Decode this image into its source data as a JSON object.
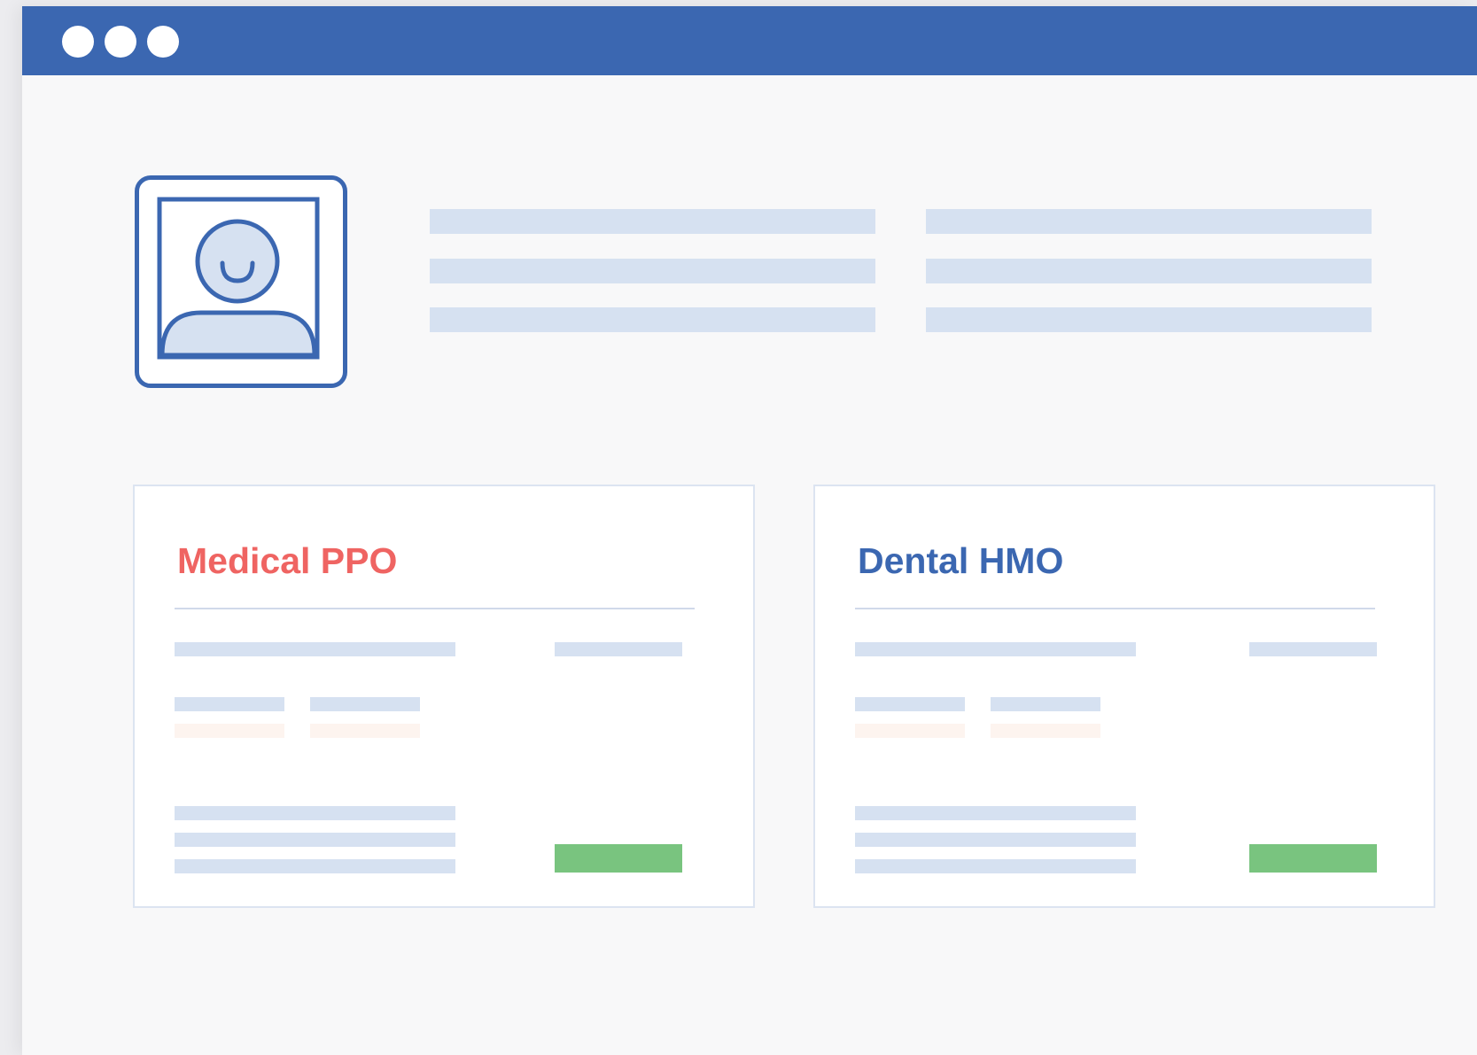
{
  "window": {
    "controls": [
      "window-dot",
      "window-dot",
      "window-dot"
    ]
  },
  "profile": {
    "avatar_icon": "user-avatar-icon"
  },
  "plans": [
    {
      "name": "Medical PPO",
      "color": "#ef6462",
      "action_color": "#79c47f"
    },
    {
      "name": "Dental HMO",
      "color": "#3b67b1",
      "action_color": "#79c47f"
    }
  ],
  "colors": {
    "titlebar": "#3b67b1",
    "placeholder": "#d6e1f1",
    "placeholder_accent": "#fdf4ef",
    "background": "#f8f8f9"
  }
}
